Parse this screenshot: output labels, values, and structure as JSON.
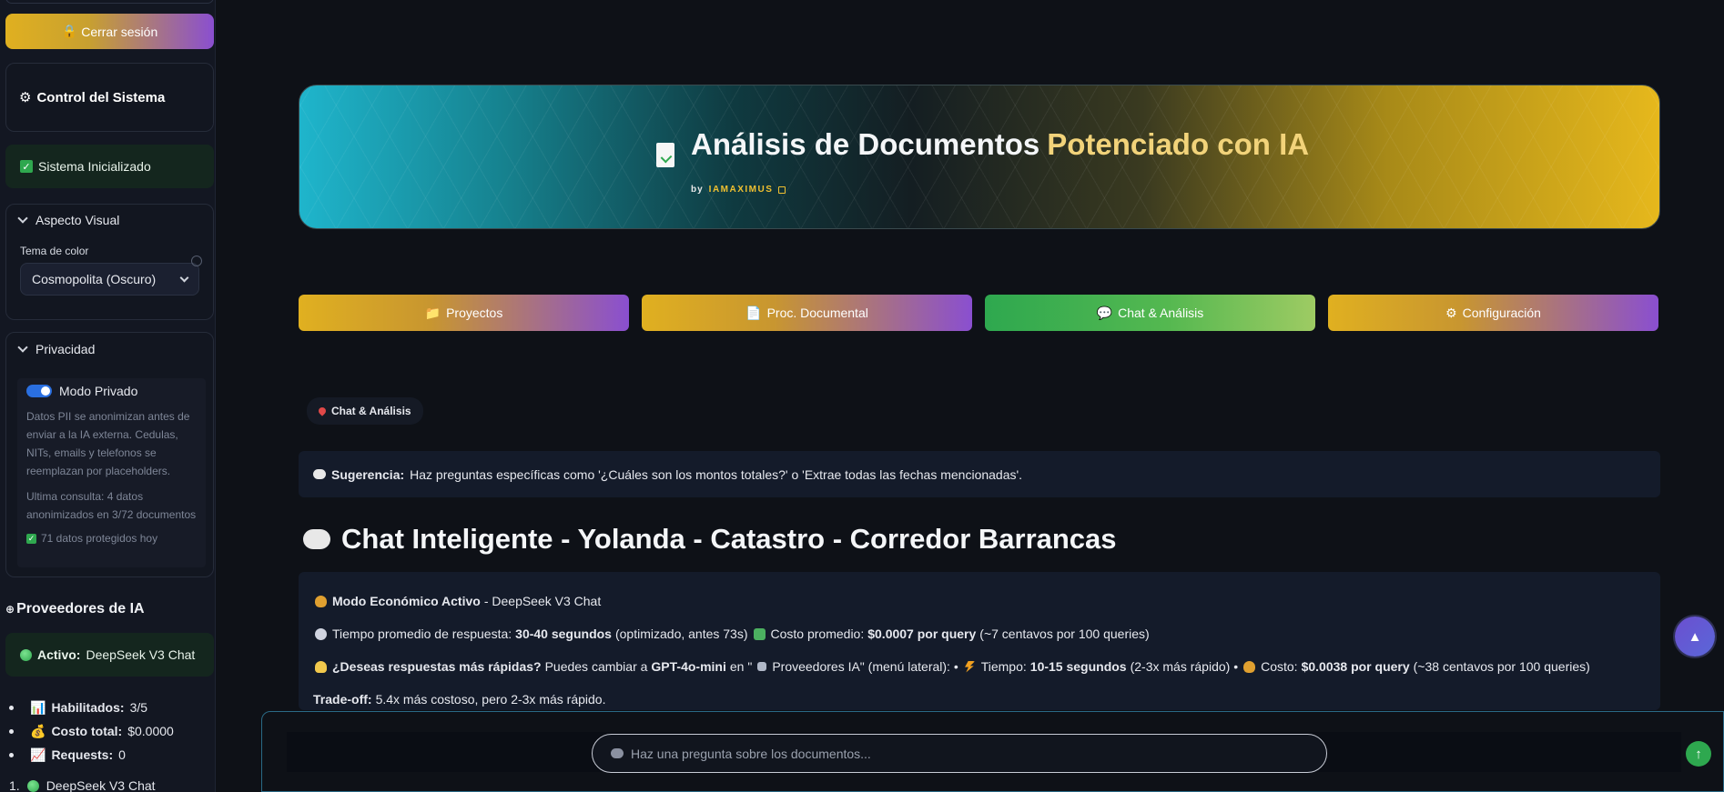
{
  "sidebar": {
    "logout_label": "Cerrar sesión",
    "control_title": "Control del Sistema",
    "initialized_text": "Sistema Inicializado",
    "visual": {
      "header": "Aspecto Visual",
      "theme_label": "Tema de color",
      "theme_value": "Cosmopolita (Oscuro)"
    },
    "privacy": {
      "header": "Privacidad",
      "toggle_label": "Modo Privado",
      "description": "Datos PII se anonimizan antes de enviar a la IA externa. Cedulas, NITs, emails y telefonos se reemplazan por placeholders.",
      "last_query": "Ultima consulta: 4 datos anonimizados en 3/72 documentos",
      "protected_today": "71 datos protegidos hoy"
    },
    "providers": {
      "title": "Proveedores de IA",
      "active_label": "Activo:",
      "active_value": "DeepSeek V3 Chat",
      "stats": [
        {
          "label": "Habilitados:",
          "value": "3/5"
        },
        {
          "label": "Costo total:",
          "value": "$0.0000"
        },
        {
          "label": "Requests:",
          "value": "0"
        }
      ],
      "first_provider": "DeepSeek V3 Chat",
      "first_number": "1."
    }
  },
  "hero": {
    "title_part1": "Análisis de Documentos",
    "title_part2": "Potenciado con IA",
    "by": "by",
    "author": "IAMAXIMUS"
  },
  "tabs": [
    {
      "label": "Proyectos"
    },
    {
      "label": "Proc. Documental"
    },
    {
      "label": "Chat & Análisis"
    },
    {
      "label": "Configuración"
    }
  ],
  "breadcrumb": "Chat & Análisis",
  "suggestion": {
    "label": "Sugerencia:",
    "text": "Haz preguntas específicas como '¿Cuáles son los montos totales?' o 'Extrae todas las fechas mencionadas'."
  },
  "chat_title": "Chat Inteligente - Yolanda - Catastro - Corredor Barrancas",
  "info": {
    "mode_label": "Modo Económico Activo",
    "mode_value": "- DeepSeek V3 Chat",
    "time_text": "Tiempo promedio de respuesta:",
    "time_value": "30-40 segundos",
    "time_note": "(optimizado, antes 73s)",
    "cost_text": "Costo promedio:",
    "cost_value": "$0.0007 por query",
    "cost_note": "(~7 centavos por 100 queries)",
    "faster_q": "¿Deseas respuestas más rápidas?",
    "faster_text": "Puedes cambiar a",
    "faster_model": "GPT-4o-mini",
    "faster_in": "en \"",
    "faster_menu": "Proveedores IA\" (menú lateral): •",
    "faster_time_label": "Tiempo:",
    "faster_time_value": "10-15 segundos",
    "faster_time_note": "(2-3x más rápido) •",
    "faster_cost_label": "Costo:",
    "faster_cost_value": "$0.0038 por query",
    "faster_cost_note": "(~38 centavos por 100 queries)",
    "tradeoff_label": "Trade-off:",
    "tradeoff_text": "5.4x más costoso, pero 2-3x más rápido."
  },
  "chat_input": {
    "placeholder": "Haz una pregunta sobre los documentos..."
  },
  "colors": {
    "accent_gold": "#e0b020",
    "accent_purple": "#8a4fd0",
    "active_green": "#2ea84f",
    "background": "#0e1117"
  },
  "icons": [
    "lock-icon",
    "gear-icon",
    "check-icon",
    "chevron-down-icon",
    "robot-icon",
    "green-dot-icon",
    "chart-icon",
    "money-bag-icon",
    "trend-icon",
    "document-icon",
    "external-link-icon",
    "folder-icon",
    "chat-bubble-icon",
    "pin-icon",
    "clock-icon",
    "money-icon",
    "bulb-icon",
    "bolt-icon",
    "send-icon",
    "arrow-up-icon"
  ]
}
